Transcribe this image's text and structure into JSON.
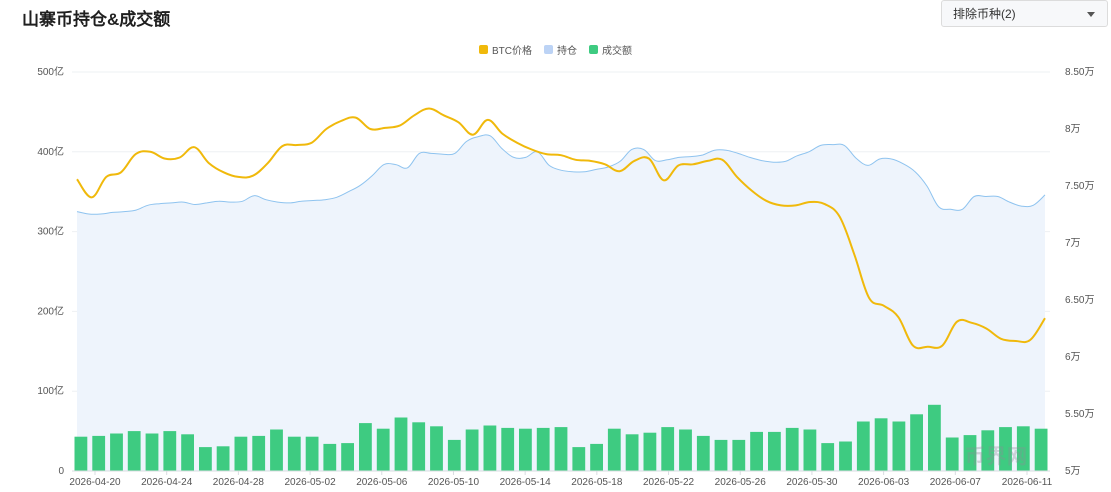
{
  "header": {
    "title": "山寨币持仓&成交额"
  },
  "filter": {
    "label": "排除币种(2)"
  },
  "watermark": {
    "text": "币界网"
  },
  "legend": [
    {
      "label": "BTC价格",
      "color": "#f0b90b"
    },
    {
      "label": "持仓",
      "color": "#bcd3f5"
    },
    {
      "label": "成交额",
      "color": "#3ecb81"
    }
  ],
  "chart_data": {
    "type": "line+area+bar",
    "x_tick_labels": [
      "2026-04-20",
      "2026-04-24",
      "2026-04-28",
      "2026-05-02",
      "2026-05-06",
      "2026-05-10",
      "2026-05-14",
      "2026-05-18",
      "2026-05-22",
      "2026-05-26",
      "2026-05-30",
      "2026-06-03",
      "2026-06-07",
      "2026-06-11"
    ],
    "y_left": {
      "ticks": [
        "0",
        "100亿",
        "200亿",
        "300亿",
        "400亿",
        "500亿"
      ],
      "range": [
        0,
        500
      ]
    },
    "y_right": {
      "ticks": [
        "5万",
        "5.50万",
        "6万",
        "6.50万",
        "7万",
        "7.50万",
        "8万",
        "8.50万"
      ],
      "range": [
        5.0,
        8.5
      ]
    },
    "series": [
      {
        "name": "BTC价格",
        "axis": "right",
        "unit": "万",
        "color": "#f0b90b",
        "values": [
          7.56,
          7.4,
          7.58,
          7.62,
          7.78,
          7.8,
          7.74,
          7.75,
          7.84,
          7.7,
          7.62,
          7.58,
          7.59,
          7.7,
          7.85,
          7.86,
          7.88,
          8.0,
          8.07,
          8.1,
          8.0,
          8.01,
          8.03,
          8.12,
          8.18,
          8.12,
          8.06,
          7.95,
          8.08,
          7.96,
          7.88,
          7.82,
          7.78,
          7.77,
          7.73,
          7.72,
          7.69,
          7.63,
          7.72,
          7.74,
          7.55,
          7.68,
          7.69,
          7.72,
          7.73,
          7.58,
          7.46,
          7.37,
          7.33,
          7.33,
          7.36,
          7.34,
          7.23,
          6.9,
          6.52,
          6.45,
          6.35,
          6.1,
          6.09,
          6.1,
          6.31,
          6.3,
          6.25,
          6.16,
          6.14,
          6.15,
          6.34
        ]
      },
      {
        "name": "持仓",
        "axis": "left",
        "unit": "亿",
        "color": "#bcd3f5",
        "values": [
          325,
          322,
          322,
          324,
          325,
          327,
          333,
          335,
          336,
          337,
          334,
          336,
          338,
          337,
          338,
          345,
          340,
          337,
          336,
          338,
          339,
          340,
          343,
          350,
          358,
          370,
          384,
          384,
          380,
          398,
          398,
          397,
          398,
          413,
          419,
          420,
          404,
          393,
          393,
          400,
          383,
          377,
          375,
          375,
          378,
          381,
          388,
          403,
          403,
          389,
          390,
          393,
          394,
          396,
          402,
          402,
          398,
          393,
          389,
          387,
          388,
          395,
          400,
          408,
          409,
          408,
          392,
          383,
          391,
          391,
          385,
          375,
          357,
          331,
          328,
          328,
          344,
          344,
          344,
          337,
          332,
          333,
          346
        ]
      },
      {
        "name": "成交额",
        "axis": "left",
        "unit": "亿",
        "color": "#3ecb81",
        "values": [
          43,
          44,
          47,
          50,
          47,
          50,
          46,
          30,
          31,
          43,
          44,
          52,
          43,
          43,
          34,
          35,
          60,
          53,
          67,
          61,
          56,
          39,
          52,
          57,
          54,
          53,
          54,
          55,
          30,
          34,
          53,
          46,
          48,
          55,
          52,
          44,
          39,
          39,
          49,
          49,
          54,
          52,
          35,
          37,
          62,
          66,
          62,
          71,
          83,
          42,
          45,
          51,
          55,
          56,
          53
        ]
      }
    ]
  }
}
